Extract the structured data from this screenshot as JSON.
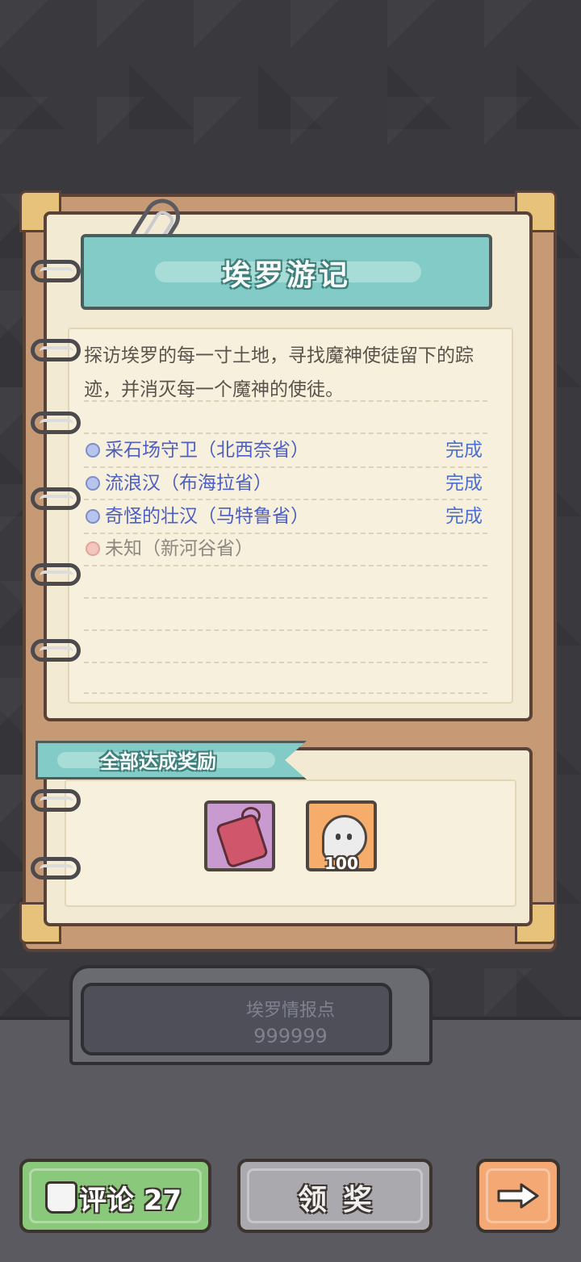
{
  "title": "埃罗游记",
  "description": "探访埃罗的每一寸土地，寻找魔神使徒留下的踪迹，并消灭每一个魔神的使徒。",
  "tasks": [
    {
      "name": "采石场守卫（北西奈省）",
      "status": "完成"
    },
    {
      "name": "流浪汉（布海拉省）",
      "status": "完成"
    },
    {
      "name": "奇怪的壮汉（马特鲁省）",
      "status": "完成"
    },
    {
      "name": "未知（新河谷省）",
      "status": ""
    }
  ],
  "reward": {
    "label": "全部达成奖励",
    "items": [
      {
        "icon": "amulet-icon",
        "count": ""
      },
      {
        "icon": "ghost-icon",
        "count": "100"
      }
    ]
  },
  "intel": {
    "label": "埃罗情报点",
    "value": "999999"
  },
  "buttons": {
    "comment": "评论 27",
    "claim": "领奖",
    "next_icon": "arrow-right-icon"
  },
  "colors": {
    "banner": "#82cbc6",
    "completed_text": "#4d5fc2",
    "status_text": "#4d6fd0",
    "comment_button": "#8ac87c",
    "next_button": "#f4a873"
  }
}
